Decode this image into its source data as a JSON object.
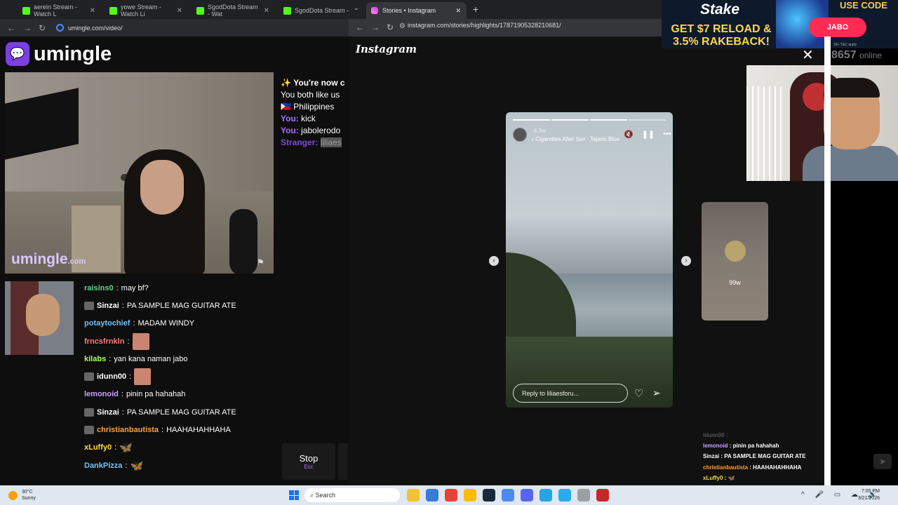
{
  "left_browser": {
    "tabs": [
      {
        "label": "aerein Stream - Watch L"
      },
      {
        "label": "yowe Stream - Watch Li"
      },
      {
        "label": "SgodDota Stream - Wat"
      },
      {
        "label": "SgodDota Stream - Wat"
      }
    ],
    "url": "umingle.com/video/"
  },
  "umingle": {
    "logo_text": "umingle",
    "watermark": "umingle",
    "watermark_suffix": ".com",
    "chat_panel": {
      "line1": "You're now c",
      "line2": "You both like us",
      "country": "Philippines",
      "you_label": "You:",
      "you_msg1": "kick",
      "you_msg2": "jabolerodo",
      "stranger_label": "Stranger:",
      "stranger_msg": "liliaes"
    },
    "stop_label": "Stop",
    "stop_key": "Esc"
  },
  "stream_chat": [
    {
      "user": "raisins0",
      "color": "#5fd38b",
      "text": "may bf?",
      "badge": false,
      "emote": ""
    },
    {
      "user": "Sinzai",
      "color": "#ffffff",
      "text": "PA SAMPLE MAG GUITAR ATE",
      "badge": true,
      "emote": ""
    },
    {
      "user": "potaytochief",
      "color": "#6ec1ff",
      "text": "MADAM WINDY",
      "badge": false,
      "emote": ""
    },
    {
      "user": "frncsfrnkln",
      "color": "#ff7a7a",
      "text": "",
      "badge": false,
      "emote": "image"
    },
    {
      "user": "kilabs",
      "color": "#a8ff60",
      "text": "yan kana naman jabo",
      "badge": false,
      "emote": ""
    },
    {
      "user": "idunn00",
      "color": "#ffffff",
      "text": "",
      "badge": true,
      "emote": "image"
    },
    {
      "user": "lemonoid",
      "color": "#c7a0ff",
      "text": "pinin pa hahahah",
      "badge": false,
      "emote": ""
    },
    {
      "user": "Sinzai",
      "color": "#ffffff",
      "text": "PA SAMPLE MAG GUITAR ATE",
      "badge": true,
      "emote": ""
    },
    {
      "user": "christianbautista",
      "color": "#ff9f40",
      "text": "HAAHAHAHHAHA",
      "badge": true,
      "emote": ""
    },
    {
      "user": "xLuffy0",
      "color": "#ffd84a",
      "text": "",
      "badge": false,
      "emote": "butterfly"
    },
    {
      "user": "DankPizza",
      "color": "#6ec1ff",
      "text": "",
      "badge": false,
      "emote": "butterfly"
    }
  ],
  "instagram_browser": {
    "tab_label": "Stories • Instagram",
    "url": "instagram.com/stories/highlights/17871905328210681/",
    "logo": "Instagram",
    "story": {
      "age": "6.3w",
      "song": "Cigarettes After Sex · Tejano Blue",
      "reply_placeholder": "Reply to liliaesforu...",
      "progress": {
        "total": 4,
        "current": 3
      }
    },
    "next_story_age": "99w"
  },
  "ad": {
    "brand": "Stake",
    "line1": "GET $7 RELOAD &",
    "line2": "3.5% RAKEBACK!",
    "use_code": "USE CODE",
    "code": "JABO",
    "terms": "18+ T&C apply"
  },
  "online_count": "8657",
  "online_label": "online",
  "overlay_chat": [
    {
      "user": "idunn00",
      "text": "",
      "color": "#555555",
      "faded": true
    },
    {
      "user": "lemonoid",
      "text": "pinin pa hahahah",
      "color": "#c7a0ff",
      "faded": false
    },
    {
      "user": "Sinzai",
      "text": "PA SAMPLE MAG GUITAR ATE",
      "color": "#ffffff",
      "faded": false
    },
    {
      "user": "christianbautista",
      "text": "HAAHAHAHHAHA",
      "color": "#ff9f40",
      "faded": false
    },
    {
      "user": "xLuffy0",
      "text": "",
      "color": "#ffd84a",
      "faded": false
    },
    {
      "user": "DankPizza",
      "text": "",
      "color": "#6ec1ff",
      "faded": false
    }
  ],
  "taskbar": {
    "temperature": "30°C",
    "weather": "Sunny",
    "search_placeholder": "Search",
    "time": "7:05 PM",
    "date": "3/21/2026"
  }
}
